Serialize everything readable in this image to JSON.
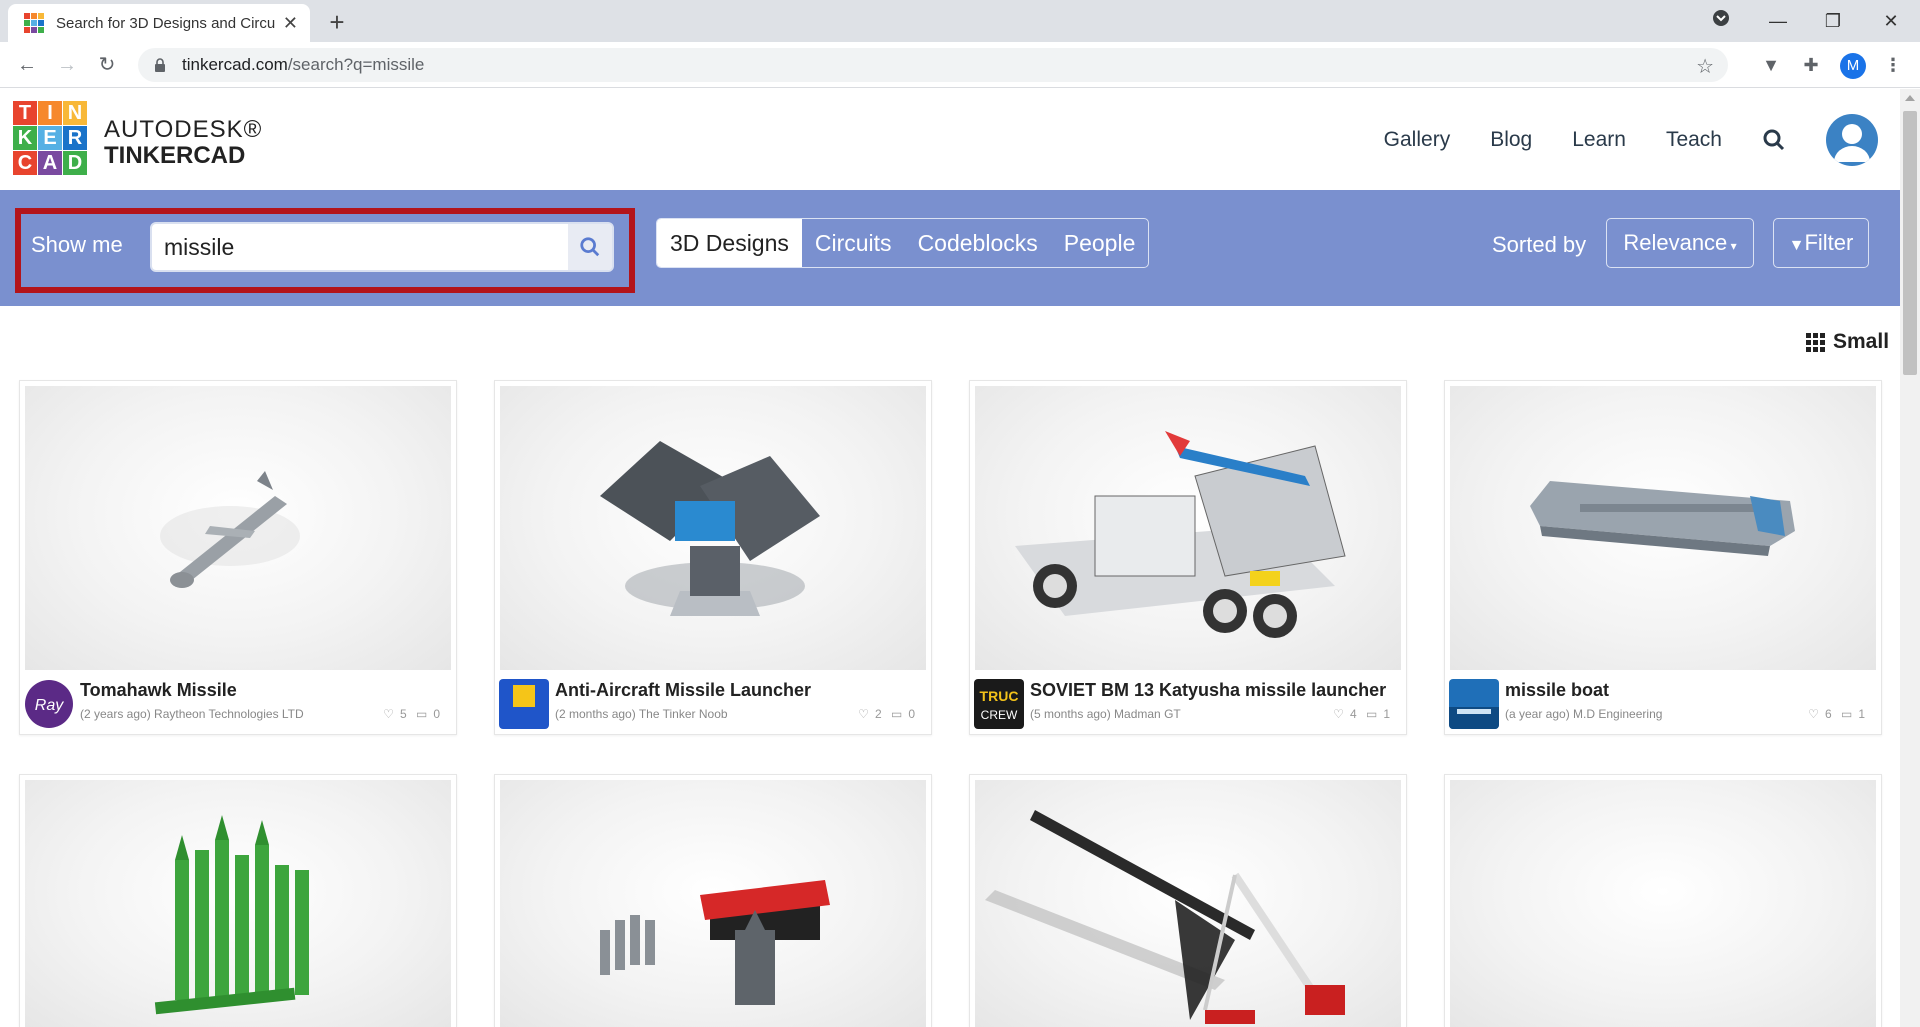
{
  "browser": {
    "tab_title": "Search for 3D Designs and Circuits",
    "url_host": "tinkercad.com",
    "url_path": "/search?q=missile",
    "profile_initial": "M"
  },
  "header": {
    "brand_line1": "AUTODESK®",
    "brand_line2": "TINKERCAD",
    "logo_letters": [
      "T",
      "I",
      "N",
      "K",
      "E",
      "R",
      "C",
      "A",
      "D"
    ],
    "logo_colors": [
      "#e8442e",
      "#f6882c",
      "#f8b838",
      "#3eaf4a",
      "#56b0e4",
      "#1a73c9",
      "#e8442e",
      "#7a4aa0",
      "#3eaf4a"
    ],
    "nav": [
      "Gallery",
      "Blog",
      "Learn",
      "Teach"
    ]
  },
  "search": {
    "show_me_label": "Show me",
    "query": "missile",
    "categories": [
      "3D Designs",
      "Circuits",
      "Codeblocks",
      "People"
    ],
    "active_category": "3D Designs",
    "sorted_by_label": "Sorted by",
    "sort_value": "Relevance",
    "filter_label": "Filter"
  },
  "view_toggle": "Small",
  "results": [
    {
      "title": "Tomahawk Missile",
      "subtitle": "(2 years ago) Raytheon Technologies LTD",
      "likes": "5",
      "comments": "0",
      "avatar_color": "#5b2a86"
    },
    {
      "title": "Anti-Aircraft Missile Launcher",
      "subtitle": "(2 months ago) The Tinker Noob",
      "likes": "2",
      "comments": "0",
      "avatar_color": "#1f55c9"
    },
    {
      "title": "SOVIET BM 13 Katyusha missile launcher",
      "subtitle": "(5 months ago) Madman GT",
      "likes": "4",
      "comments": "1",
      "avatar_color": "#1a1a1a",
      "avatar_text": "TRUC CREW"
    },
    {
      "title": "missile boat",
      "subtitle": "(a year ago) M.D Engineering",
      "likes": "6",
      "comments": "1",
      "avatar_color": "#1f6fb8"
    },
    {
      "title": "",
      "subtitle": "",
      "likes": "",
      "comments": ""
    },
    {
      "title": "",
      "subtitle": "",
      "likes": "",
      "comments": ""
    },
    {
      "title": "",
      "subtitle": "",
      "likes": "",
      "comments": ""
    },
    {
      "title": "",
      "subtitle": "",
      "likes": "",
      "comments": ""
    }
  ],
  "colors": {
    "band": "#7a90cf",
    "highlight": "#b3141a"
  }
}
